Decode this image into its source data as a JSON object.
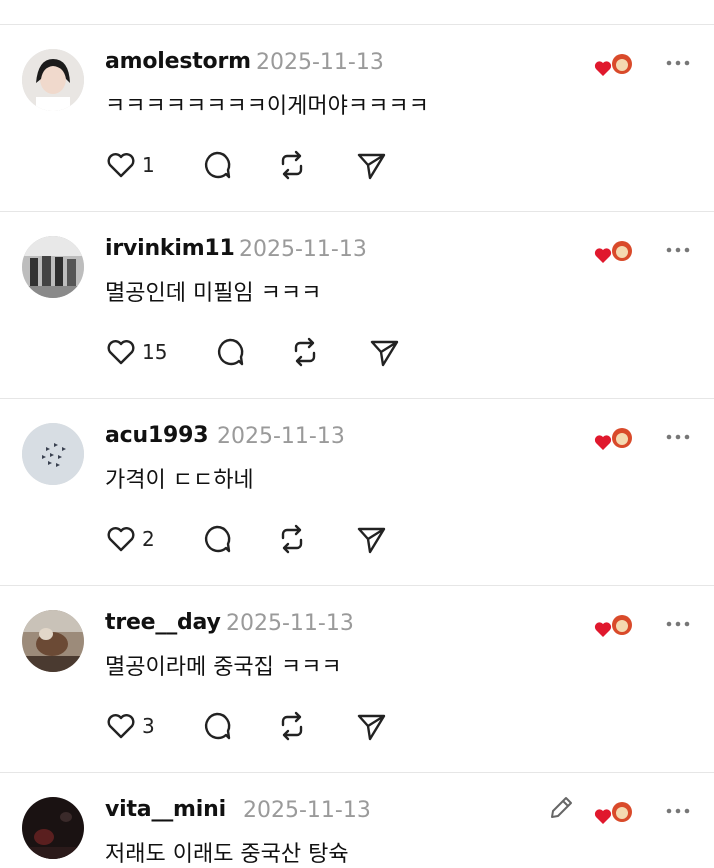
{
  "comments": [
    {
      "username": "amolestorm",
      "date": "2025-11-13",
      "text": "ㅋㅋㅋㅋㅋㅋㅋㅋ이게머야ㅋㅋㅋㅋ",
      "likes": "1"
    },
    {
      "username": "irvinkim11",
      "date": "2025-11-13",
      "text": "멸공인데 미필임 ㅋㅋㅋ",
      "likes": "15"
    },
    {
      "username": "acu1993",
      "date": "2025-11-13",
      "text": "가격이 ㄷㄷ하네",
      "likes": "2"
    },
    {
      "username": "tree__day",
      "date": "2025-11-13",
      "text": "멸공이라메 중국집 ㅋㅋㅋ",
      "likes": "3"
    },
    {
      "username": "vita__mini",
      "date": "2025-11-13",
      "text": "저래도 이래도 중국산 탕슉"
    }
  ],
  "colors": {
    "heart": "#e0182d",
    "muted": "#9a9a9a",
    "divider": "#e6e6e6"
  }
}
